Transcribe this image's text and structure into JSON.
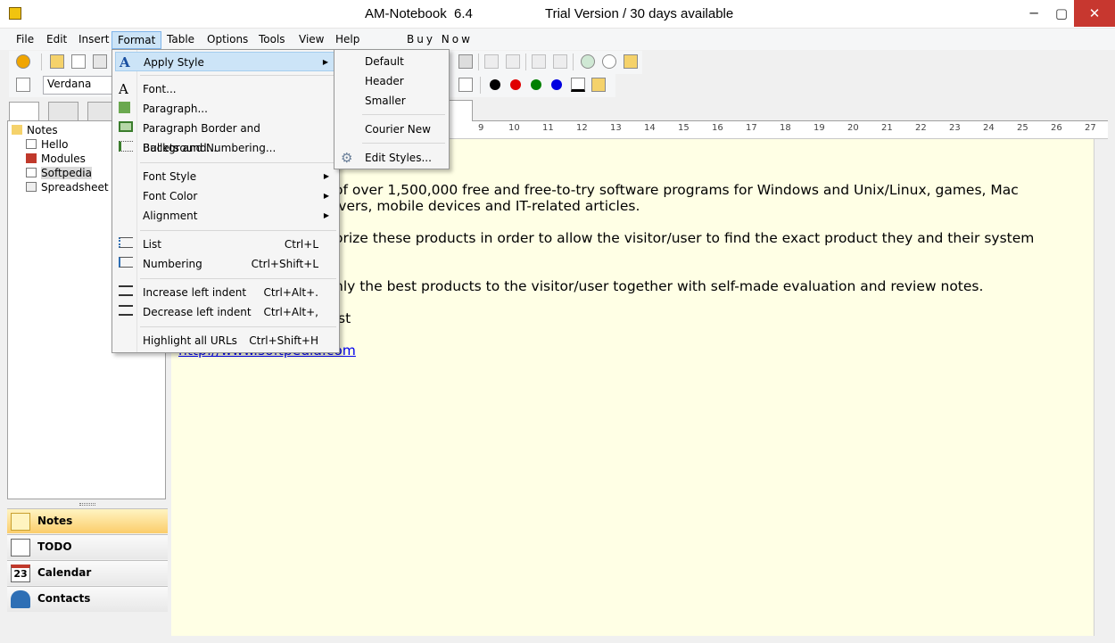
{
  "window": {
    "title": "AM-Notebook  6.4",
    "trial": "Trial Version / 30 days available",
    "min": "─",
    "max": "▢",
    "close": "✕"
  },
  "menubar": {
    "items": [
      "File",
      "Edit",
      "Insert",
      "Format",
      "Table",
      "Options",
      "Tools",
      "View",
      "Help"
    ],
    "buy_now": "Buy Now"
  },
  "toolbar": {
    "font_name": "Verdana",
    "colors": [
      "#000000",
      "#e00000",
      "#008000",
      "#0000e0"
    ]
  },
  "tree": {
    "root": "Notes",
    "items": [
      "Hello",
      "Modules",
      "Softpedia",
      "Spreadsheet"
    ]
  },
  "nav": {
    "items": [
      "Notes",
      "TODO",
      "Calendar",
      "Contacts"
    ],
    "calendar_day": "23"
  },
  "ruler": {
    "ticks": [
      "9",
      "10",
      "11",
      "12",
      "13",
      "14",
      "15",
      "16",
      "17",
      "18",
      "19",
      "20",
      "21",
      "22",
      "23",
      "24",
      "25",
      "26",
      "27"
    ]
  },
  "editor": {
    "line1": "of over 1,500,000 free and free-to-try software programs for Windows and Unix/Linux, games, Mac",
    "line2": "ivers, mobile devices and IT-related articles.",
    "line3": "orize these products in order to allow the visitor/user to find the exact product they and their system",
    "line4": "nly the best products to the visitor/user together with self-made evaluation and review notes.",
    "line5": "st",
    "link": "http://www.softpedia.com"
  },
  "format_menu": {
    "apply_style": "Apply Style",
    "font": "Font...",
    "paragraph": "Paragraph...",
    "border": "Paragraph Border and Background...",
    "bullets": "Bullets and Numbering...",
    "font_style": "Font Style",
    "font_color": "Font Color",
    "alignment": "Alignment",
    "list": "List",
    "list_sc": "Ctrl+L",
    "numbering": "Numbering",
    "numbering_sc": "Ctrl+Shift+L",
    "increase": "Increase left indent",
    "increase_sc": "Ctrl+Alt+.",
    "decrease": "Decrease left indent",
    "decrease_sc": "Ctrl+Alt+,",
    "highlight": "Highlight all URLs",
    "highlight_sc": "Ctrl+Shift+H"
  },
  "style_submenu": {
    "default": "Default",
    "header": "Header",
    "smaller": "Smaller",
    "courier": "Courier New",
    "edit": "Edit Styles..."
  }
}
